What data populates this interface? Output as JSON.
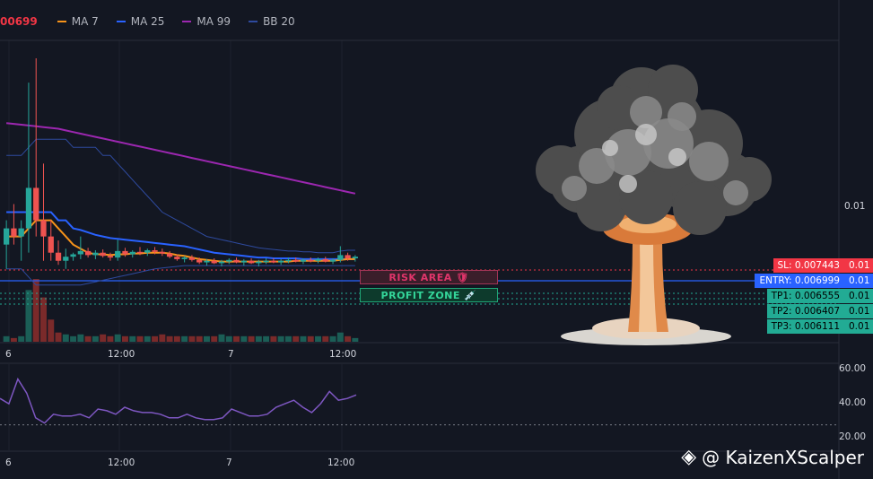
{
  "legend": {
    "price": "00699",
    "items": [
      {
        "label": "MA 7",
        "color": "#f7931a"
      },
      {
        "label": "MA 25",
        "color": "#2962ff"
      },
      {
        "label": "MA 99",
        "color": "#9c27b0"
      },
      {
        "label": "BB 20",
        "color": "#2e4a9e"
      }
    ]
  },
  "price_scale": {
    "label_001": "0.01",
    "levels": [
      {
        "kind": "sl",
        "text": "SL: 0.007443",
        "value": 0.007443,
        "right_text": "0.01"
      },
      {
        "kind": "entry",
        "text": "ENTRY: 0.006999",
        "value": 0.006999,
        "right_text": "0.01"
      },
      {
        "kind": "tp",
        "text": "TP1: 0.006555",
        "value": 0.006555,
        "right_text": "0.01"
      },
      {
        "kind": "tp",
        "text": "TP2: 0.006407",
        "value": 0.006407,
        "right_text": "0.01"
      },
      {
        "kind": "tp",
        "text": "TP3: 0.006111",
        "value": 0.006111,
        "right_text": "0.01"
      }
    ]
  },
  "zones": {
    "risk": "RISK AREA",
    "risk_icon": "🛡",
    "profit": "PROFIT ZONE",
    "profit_icon": "💉"
  },
  "time_axis": {
    "labels": [
      "6",
      "12:00",
      "7",
      "12:00"
    ]
  },
  "rsi_axis": {
    "labels": [
      "60.00",
      "40.00",
      "20.00"
    ]
  },
  "watermark": {
    "text": "@ KaizenXScalper",
    "icon": "binance-icon"
  },
  "chart_data": [
    {
      "type": "candlestick",
      "name": "price",
      "candles": [
        [
          0.0071,
          0.0074,
          0.0068,
          0.0073
        ],
        [
          0.0073,
          0.0076,
          0.0071,
          0.0072
        ],
        [
          0.0072,
          0.0074,
          0.0069,
          0.0073
        ],
        [
          0.0073,
          0.0091,
          0.007,
          0.0078
        ],
        [
          0.0078,
          0.0094,
          0.0072,
          0.0074
        ],
        [
          0.0074,
          0.0081,
          0.0069,
          0.0072
        ],
        [
          0.0072,
          0.0074,
          0.0069,
          0.007
        ],
        [
          0.007,
          0.00715,
          0.00685,
          0.0069
        ],
        [
          0.0069,
          0.00705,
          0.0068,
          0.00695
        ],
        [
          0.00695,
          0.007,
          0.0069,
          0.00698
        ],
        [
          0.00698,
          0.0072,
          0.00692,
          0.00702
        ],
        [
          0.00702,
          0.00706,
          0.00694,
          0.00697
        ],
        [
          0.00697,
          0.00703,
          0.00692,
          0.007
        ],
        [
          0.007,
          0.00704,
          0.00694,
          0.00696
        ],
        [
          0.00696,
          0.007,
          0.0069,
          0.00694
        ],
        [
          0.00694,
          0.00716,
          0.0069,
          0.00702
        ],
        [
          0.00702,
          0.00706,
          0.00695,
          0.00698
        ],
        [
          0.00698,
          0.00703,
          0.00694,
          0.00701
        ],
        [
          0.00701,
          0.00707,
          0.00697,
          0.007
        ],
        [
          0.007,
          0.00705,
          0.00696,
          0.00703
        ],
        [
          0.00703,
          0.00707,
          0.00698,
          0.00701
        ],
        [
          0.00701,
          0.00705,
          0.00696,
          0.00699
        ],
        [
          0.00699,
          0.00702,
          0.00693,
          0.00695
        ],
        [
          0.00695,
          0.00698,
          0.0069,
          0.00692
        ],
        [
          0.00692,
          0.00696,
          0.00688,
          0.00694
        ],
        [
          0.00694,
          0.00697,
          0.00689,
          0.00691
        ],
        [
          0.00691,
          0.00694,
          0.00686,
          0.00688
        ],
        [
          0.00688,
          0.00692,
          0.00684,
          0.0069
        ],
        [
          0.0069,
          0.00693,
          0.00686,
          0.00687
        ],
        [
          0.00687,
          0.00691,
          0.00683,
          0.00689
        ],
        [
          0.00689,
          0.00693,
          0.00686,
          0.00691
        ],
        [
          0.00691,
          0.00694,
          0.00687,
          0.00688
        ],
        [
          0.00688,
          0.00692,
          0.00684,
          0.0069
        ],
        [
          0.0069,
          0.00693,
          0.00686,
          0.00687
        ],
        [
          0.00687,
          0.00691,
          0.00683,
          0.00689
        ],
        [
          0.00689,
          0.00693,
          0.00686,
          0.0069
        ],
        [
          0.0069,
          0.00693,
          0.00687,
          0.00688
        ],
        [
          0.00688,
          0.00692,
          0.00685,
          0.0069
        ],
        [
          0.0069,
          0.00694,
          0.00687,
          0.00691
        ],
        [
          0.00691,
          0.00694,
          0.00688,
          0.00689
        ],
        [
          0.00689,
          0.00693,
          0.00686,
          0.00691
        ],
        [
          0.00691,
          0.00694,
          0.00688,
          0.0069
        ],
        [
          0.0069,
          0.00694,
          0.00687,
          0.00692
        ],
        [
          0.00692,
          0.00695,
          0.00688,
          0.00689
        ],
        [
          0.00689,
          0.00693,
          0.00686,
          0.00691
        ],
        [
          0.00691,
          0.00708,
          0.00688,
          0.00697
        ],
        [
          0.00697,
          0.007,
          0.0069,
          0.00693
        ],
        [
          0.00693,
          0.00697,
          0.00689,
          0.00695
        ]
      ],
      "volumes": [
        3,
        2,
        3,
        28,
        34,
        24,
        12,
        5,
        4,
        3,
        4,
        3,
        3,
        4,
        3,
        4,
        3,
        3,
        3,
        3,
        3,
        4,
        3,
        3,
        3,
        3,
        3,
        3,
        3,
        4,
        3,
        3,
        3,
        3,
        3,
        3,
        3,
        3,
        3,
        3,
        3,
        3,
        3,
        3,
        3,
        5,
        3,
        2
      ],
      "ma7": [
        0.0072,
        0.0072,
        0.0072,
        0.0073,
        0.0074,
        0.0074,
        0.0074,
        0.0073,
        0.0072,
        0.0071,
        0.00705,
        0.007,
        0.00698,
        0.00698,
        0.00697,
        0.00698,
        0.00698,
        0.00699,
        0.00699,
        0.007,
        0.007,
        0.007,
        0.00699,
        0.00697,
        0.00696,
        0.00694,
        0.00692,
        0.00691,
        0.0069,
        0.00689,
        0.00689,
        0.00689,
        0.00689,
        0.00689,
        0.00689,
        0.00689,
        0.00689,
        0.00689,
        0.00689,
        0.0069,
        0.0069,
        0.0069,
        0.0069,
        0.0069,
        0.0069,
        0.00691,
        0.00692,
        0.00692
      ],
      "ma25": [
        0.0075,
        0.0075,
        0.0075,
        0.0075,
        0.0075,
        0.0075,
        0.0075,
        0.0074,
        0.0074,
        0.0073,
        0.00728,
        0.00725,
        0.00722,
        0.0072,
        0.00718,
        0.00717,
        0.00716,
        0.00715,
        0.00714,
        0.00713,
        0.00712,
        0.00711,
        0.0071,
        0.00709,
        0.00708,
        0.00706,
        0.00704,
        0.00702,
        0.007,
        0.00699,
        0.00698,
        0.00697,
        0.00696,
        0.00695,
        0.00694,
        0.00694,
        0.00693,
        0.00693,
        0.00693,
        0.00693,
        0.00692,
        0.00692,
        0.00692,
        0.00692,
        0.00692,
        0.00692,
        0.00692,
        0.00692
      ],
      "ma99": [
        0.0086,
        0.00859,
        0.00858,
        0.00857,
        0.00856,
        0.00855,
        0.00854,
        0.00853,
        0.00851,
        0.00849,
        0.00847,
        0.00845,
        0.00843,
        0.00841,
        0.00839,
        0.00837,
        0.00835,
        0.00833,
        0.00831,
        0.00829,
        0.00827,
        0.00825,
        0.00823,
        0.00821,
        0.00819,
        0.00817,
        0.00815,
        0.00813,
        0.00811,
        0.00809,
        0.00807,
        0.00805,
        0.00803,
        0.00801,
        0.00799,
        0.00797,
        0.00795,
        0.00793,
        0.00791,
        0.00789,
        0.00787,
        0.00785,
        0.00783,
        0.00781,
        0.00779,
        0.00777,
        0.00775,
        0.00773
      ],
      "bb_upper": [
        0.0082,
        0.0082,
        0.0082,
        0.0083,
        0.0084,
        0.0084,
        0.0084,
        0.0084,
        0.0084,
        0.0083,
        0.0083,
        0.0083,
        0.0083,
        0.0082,
        0.0082,
        0.0081,
        0.008,
        0.0079,
        0.0078,
        0.0077,
        0.0076,
        0.0075,
        0.00745,
        0.0074,
        0.00735,
        0.0073,
        0.00725,
        0.0072,
        0.00718,
        0.00716,
        0.00714,
        0.00712,
        0.0071,
        0.00708,
        0.00706,
        0.00705,
        0.00704,
        0.00703,
        0.00702,
        0.00702,
        0.00701,
        0.00701,
        0.007,
        0.007,
        0.007,
        0.00702,
        0.00703,
        0.00703
      ],
      "bb_lower": [
        0.0068,
        0.0068,
        0.0068,
        0.0067,
        0.0066,
        0.0066,
        0.0066,
        0.0066,
        0.0066,
        0.0066,
        0.0066,
        0.00662,
        0.00664,
        0.00666,
        0.00668,
        0.0067,
        0.00672,
        0.00674,
        0.00676,
        0.00678,
        0.0068,
        0.00681,
        0.00682,
        0.00683,
        0.00684,
        0.00684,
        0.00684,
        0.00684,
        0.00684,
        0.00684,
        0.00684,
        0.00684,
        0.00684,
        0.00684,
        0.00684,
        0.00684,
        0.00684,
        0.00684,
        0.00684,
        0.00684,
        0.00684,
        0.00684,
        0.00684,
        0.00684,
        0.00684,
        0.00684,
        0.00684,
        0.00684
      ],
      "colors": {
        "up": "#26a69a",
        "down": "#ef5350",
        "vol_up": "#1b5e56",
        "vol_down": "#7a2a2a"
      }
    },
    {
      "type": "line",
      "name": "RSI",
      "values": [
        45,
        42,
        56,
        48,
        34,
        31,
        36,
        35,
        35,
        36,
        34,
        39,
        38,
        36,
        40,
        38,
        37,
        37,
        36,
        34,
        34,
        36,
        34,
        33,
        33,
        34,
        39,
        37,
        35,
        35,
        36,
        40,
        42,
        44,
        40,
        37,
        42,
        49,
        44,
        45,
        47
      ],
      "ylim": [
        15,
        65
      ],
      "reference": 30,
      "color": "#7e57c2"
    }
  ]
}
